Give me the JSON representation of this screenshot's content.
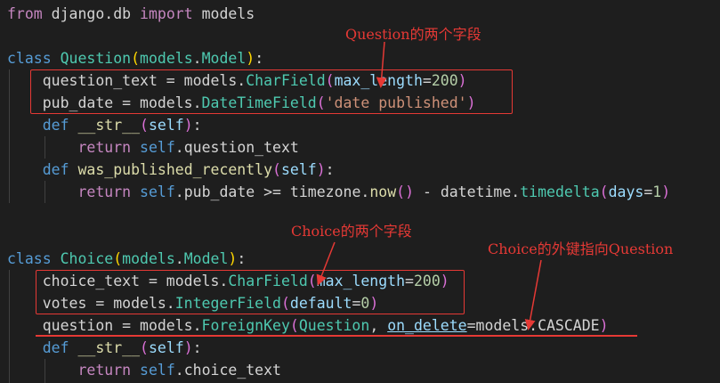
{
  "code_lines": [
    {
      "tokens": [
        {
          "t": "from",
          "c": "kw2"
        },
        {
          "t": " django.db ",
          "c": "pl"
        },
        {
          "t": "import",
          "c": "kw2"
        },
        {
          "t": " models",
          "c": "pl"
        }
      ]
    },
    {
      "tokens": []
    },
    {
      "tokens": [
        {
          "t": "class",
          "c": "kw"
        },
        {
          "t": " ",
          "c": "pl"
        },
        {
          "t": "Question",
          "c": "cls"
        },
        {
          "t": "(",
          "c": "p1"
        },
        {
          "t": "models",
          "c": "cls"
        },
        {
          "t": ".",
          "c": "pl"
        },
        {
          "t": "Model",
          "c": "cls"
        },
        {
          "t": ")",
          "c": "p1"
        },
        {
          "t": ":",
          "c": "pl"
        }
      ]
    },
    {
      "tokens": [
        {
          "t": "    question_text = models.",
          "c": "pl"
        },
        {
          "t": "CharField",
          "c": "cls"
        },
        {
          "t": "(",
          "c": "p2"
        },
        {
          "t": "max_length",
          "c": "var"
        },
        {
          "t": "=",
          "c": "pl"
        },
        {
          "t": "200",
          "c": "num"
        },
        {
          "t": ")",
          "c": "p2"
        }
      ]
    },
    {
      "tokens": [
        {
          "t": "    pub_date = models.",
          "c": "pl"
        },
        {
          "t": "DateTimeField",
          "c": "cls"
        },
        {
          "t": "(",
          "c": "p2"
        },
        {
          "t": "'date published'",
          "c": "str"
        },
        {
          "t": ")",
          "c": "p2"
        }
      ]
    },
    {
      "tokens": [
        {
          "t": "    ",
          "c": "pl"
        },
        {
          "t": "def",
          "c": "kw"
        },
        {
          "t": " ",
          "c": "pl"
        },
        {
          "t": "__str__",
          "c": "fn"
        },
        {
          "t": "(",
          "c": "p2"
        },
        {
          "t": "self",
          "c": "var"
        },
        {
          "t": ")",
          "c": "p2"
        },
        {
          "t": ":",
          "c": "pl"
        }
      ]
    },
    {
      "tokens": [
        {
          "t": "        ",
          "c": "pl"
        },
        {
          "t": "return",
          "c": "ret"
        },
        {
          "t": " ",
          "c": "pl"
        },
        {
          "t": "self",
          "c": "self"
        },
        {
          "t": ".question_text",
          "c": "pl"
        }
      ]
    },
    {
      "tokens": [
        {
          "t": "    ",
          "c": "pl"
        },
        {
          "t": "def",
          "c": "kw"
        },
        {
          "t": " ",
          "c": "pl"
        },
        {
          "t": "was_published_recently",
          "c": "fn"
        },
        {
          "t": "(",
          "c": "p2"
        },
        {
          "t": "self",
          "c": "var"
        },
        {
          "t": ")",
          "c": "p2"
        },
        {
          "t": ":",
          "c": "pl"
        }
      ]
    },
    {
      "tokens": [
        {
          "t": "        ",
          "c": "pl"
        },
        {
          "t": "return",
          "c": "ret"
        },
        {
          "t": " ",
          "c": "pl"
        },
        {
          "t": "self",
          "c": "self"
        },
        {
          "t": ".pub_date >= timezone.",
          "c": "pl"
        },
        {
          "t": "now",
          "c": "fn"
        },
        {
          "t": "()",
          "c": "p2"
        },
        {
          "t": " - datetime.",
          "c": "pl"
        },
        {
          "t": "timedelta",
          "c": "cls"
        },
        {
          "t": "(",
          "c": "p2"
        },
        {
          "t": "days",
          "c": "var"
        },
        {
          "t": "=",
          "c": "pl"
        },
        {
          "t": "1",
          "c": "num"
        },
        {
          "t": ")",
          "c": "p2"
        }
      ]
    },
    {
      "tokens": []
    },
    {
      "tokens": []
    },
    {
      "tokens": [
        {
          "t": "class",
          "c": "kw"
        },
        {
          "t": " ",
          "c": "pl"
        },
        {
          "t": "Choice",
          "c": "cls"
        },
        {
          "t": "(",
          "c": "p1"
        },
        {
          "t": "models",
          "c": "cls"
        },
        {
          "t": ".",
          "c": "pl"
        },
        {
          "t": "Model",
          "c": "cls"
        },
        {
          "t": ")",
          "c": "p1"
        },
        {
          "t": ":",
          "c": "pl"
        }
      ]
    },
    {
      "tokens": [
        {
          "t": "    choice_text = models.",
          "c": "pl"
        },
        {
          "t": "CharField",
          "c": "cls"
        },
        {
          "t": "(",
          "c": "p2"
        },
        {
          "t": "max_length",
          "c": "var"
        },
        {
          "t": "=",
          "c": "pl"
        },
        {
          "t": "200",
          "c": "num"
        },
        {
          "t": ")",
          "c": "p2"
        }
      ]
    },
    {
      "tokens": [
        {
          "t": "    votes = models.",
          "c": "pl"
        },
        {
          "t": "IntegerField",
          "c": "cls"
        },
        {
          "t": "(",
          "c": "p2"
        },
        {
          "t": "default",
          "c": "var"
        },
        {
          "t": "=",
          "c": "pl"
        },
        {
          "t": "0",
          "c": "num"
        },
        {
          "t": ")",
          "c": "p2"
        }
      ]
    },
    {
      "tokens": [
        {
          "t": "    question = models.",
          "c": "pl"
        },
        {
          "t": "ForeignKey",
          "c": "cls"
        },
        {
          "t": "(",
          "c": "p2"
        },
        {
          "t": "Question",
          "c": "cls"
        },
        {
          "t": ", ",
          "c": "pl"
        },
        {
          "t": "on_delete",
          "c": "var ul"
        },
        {
          "t": "=models.CASCADE",
          "c": "pl"
        },
        {
          "t": ")",
          "c": "p2"
        }
      ]
    },
    {
      "tokens": [
        {
          "t": "    ",
          "c": "pl"
        },
        {
          "t": "def",
          "c": "kw"
        },
        {
          "t": " ",
          "c": "pl"
        },
        {
          "t": "__str__",
          "c": "fn"
        },
        {
          "t": "(",
          "c": "p2"
        },
        {
          "t": "self",
          "c": "var"
        },
        {
          "t": ")",
          "c": "p2"
        },
        {
          "t": ":",
          "c": "pl"
        }
      ]
    },
    {
      "tokens": [
        {
          "t": "        ",
          "c": "pl"
        },
        {
          "t": "return",
          "c": "ret"
        },
        {
          "t": " ",
          "c": "pl"
        },
        {
          "t": "self",
          "c": "self"
        },
        {
          "t": ".choice_text",
          "c": "pl"
        }
      ]
    }
  ],
  "annotations": {
    "question_fields": "Question的两个字段",
    "choice_fields": "Choice的两个字段",
    "foreign_key": "Choice的外键指向Question"
  },
  "colors": {
    "background": "#1e1e1e",
    "annotation": "#e53935"
  }
}
